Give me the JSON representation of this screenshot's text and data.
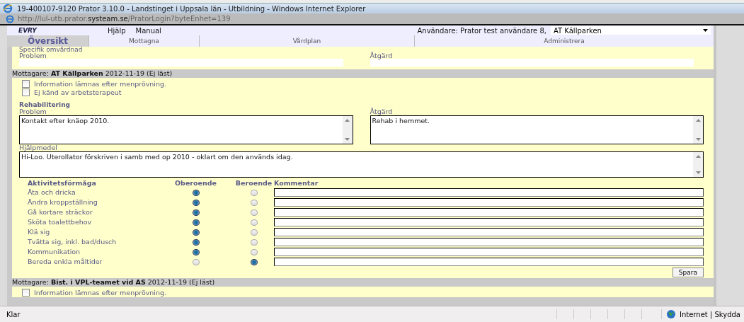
{
  "window": {
    "title": "19-400107-9120   Prator 3.10.0 - Landstinget i Uppsala län - Utbildning - Windows Internet Explorer"
  },
  "address_bar": {
    "url": "http://lul-utb.prator.**systeam.se**/PratorLogin?byteEnhet=139"
  },
  "header": {
    "logo": "EVRY",
    "menu": [
      "Hjälp",
      "Manual"
    ],
    "user_label": "Användare: Prator test användare 8,",
    "unit_select": {
      "value": "AT Källparken"
    }
  },
  "tabs": [
    {
      "label": "Översikt",
      "selected": true
    },
    {
      "label": "Mottagna",
      "selected": false
    },
    {
      "label": "Vårdplan",
      "selected": false
    },
    {
      "label": "Administrera",
      "selected": false
    }
  ],
  "top_section": {
    "title": "Specifik omvårdnad",
    "problem_label": "Problem",
    "action_label": "Åtgärd"
  },
  "recipients": [
    {
      "header": "Mottagare: **AT Källparken** 2012-11-19  (Ej läst)",
      "checkboxes": [
        {
          "label": "Information lämnas efter menprövning.",
          "checked": false
        },
        {
          "label": "Ej känd av arbetsterapeut",
          "checked": false
        }
      ],
      "rehab": {
        "title": "Rehabilitering",
        "problem_label": "Problem",
        "problem": "Kontakt efter knäop 2010.",
        "action_label": "Åtgärd",
        "action": "Rehab i hemmet.",
        "aids_label": "Hjälpmedel",
        "aids": "Hi-Loo. Uterollator förskriven i samb med op 2010 - oklart om den används idag."
      },
      "activity_table": {
        "columns": [
          "Aktivitetsförmåga",
          "Oberoende",
          "Beroende",
          "Kommentar"
        ],
        "rows": [
          {
            "activity": "Äta och dricka",
            "options": [
              {
                "selected": true
              },
              {
                "selected": false
              }
            ]
          },
          {
            "activity": "Ändra kroppställning",
            "options": [
              {
                "selected": true
              },
              {
                "selected": false
              }
            ]
          },
          {
            "activity": "Gå kortare sträckor",
            "options": [
              {
                "selected": true
              },
              {
                "selected": false
              }
            ]
          },
          {
            "activity": "Sköta toalettbehov",
            "options": [
              {
                "selected": true
              },
              {
                "selected": false
              }
            ]
          },
          {
            "activity": "Klä sig",
            "options": [
              {
                "selected": true
              },
              {
                "selected": false
              }
            ]
          },
          {
            "activity": "Tvätta sig, inkl. bad/dusch",
            "options": [
              {
                "selected": true
              },
              {
                "selected": false
              }
            ]
          },
          {
            "activity": "Kommunikation",
            "options": [
              {
                "selected": true
              },
              {
                "selected": false
              }
            ]
          },
          {
            "activity": "Bereda enkla måltider",
            "options": [
              {
                "selected": false
              },
              {
                "selected": true
              }
            ]
          }
        ]
      },
      "save_button": "Spara"
    },
    {
      "header": "Mottagare: **Bist. i VPL-teamet vid AS** 2012-11-19  (Ej läst)",
      "checkboxes": [
        {
          "label": "Information lämnas efter menprövning.",
          "checked": false
        }
      ]
    }
  ],
  "status_bar": {
    "status": "Klar",
    "zone": "Internet | Skydda"
  }
}
